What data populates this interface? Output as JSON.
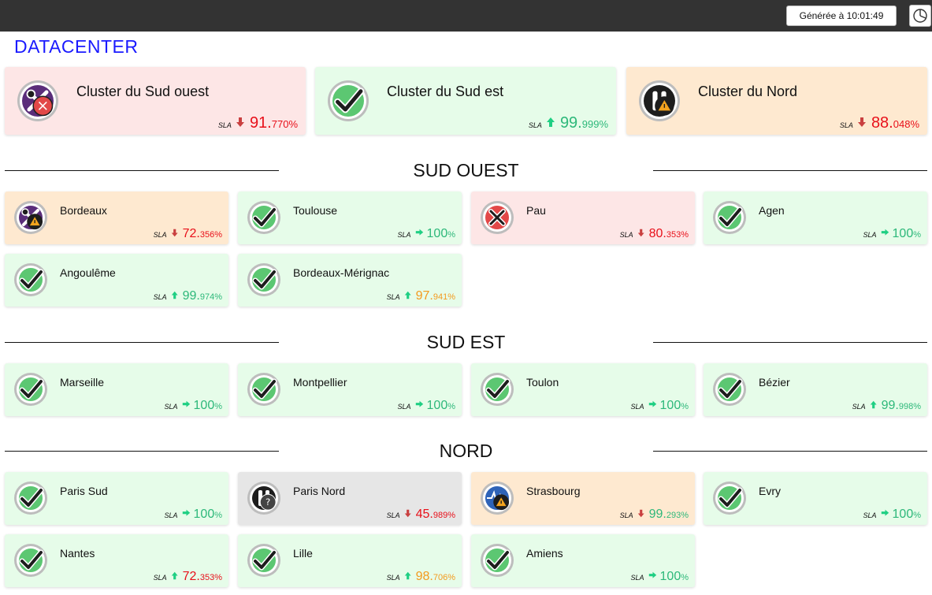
{
  "header": {
    "generated_label": "Générée à 10:01:49",
    "pie_icon": "pie-chart-icon"
  },
  "page_title": "DATACENTER",
  "sla_label": "SLA",
  "colors": {
    "ok": "#e6fce9",
    "critical": "#fde6e6",
    "warning": "#fee9d0",
    "unknown": "#e6e6e6",
    "value_green": "#2db87a",
    "value_red": "#e8101a",
    "value_orange": "#f39a1e",
    "arrow_green": "#1fcf83",
    "arrow_red": "#c94040"
  },
  "clusters": [
    {
      "name": "Cluster du Sud ouest",
      "status": "crit",
      "icon": "maintenance-critical",
      "trend": "down",
      "int": "91.",
      "dec": "770%",
      "color": "red"
    },
    {
      "name": "Cluster du Sud est",
      "status": "ok",
      "icon": "check",
      "trend": "up",
      "int": "99.",
      "dec": "999%",
      "color": "green"
    },
    {
      "name": "Cluster du Nord",
      "status": "warn",
      "icon": "pause-warning",
      "trend": "down",
      "int": "88.",
      "dec": "048%",
      "color": "red"
    }
  ],
  "sections": [
    {
      "title": "SUD OUEST",
      "sites": [
        {
          "name": "Bordeaux",
          "status": "warn",
          "icon": "maintenance-warning",
          "trend": "down",
          "int": "72.",
          "dec": "356%",
          "color": "red"
        },
        {
          "name": "Toulouse",
          "status": "ok",
          "icon": "check",
          "trend": "right",
          "int": "100",
          "dec": "%",
          "color": "green"
        },
        {
          "name": "Pau",
          "status": "crit",
          "icon": "cross",
          "trend": "down",
          "int": "80.",
          "dec": "353%",
          "color": "red"
        },
        {
          "name": "Agen",
          "status": "ok",
          "icon": "check",
          "trend": "right",
          "int": "100",
          "dec": "%",
          "color": "green"
        },
        {
          "name": "Angoulême",
          "status": "ok",
          "icon": "check",
          "trend": "up",
          "int": "99.",
          "dec": "974%",
          "color": "green"
        },
        {
          "name": "Bordeaux-Mérignac",
          "status": "ok",
          "icon": "check",
          "trend": "up",
          "int": "97.",
          "dec": "941%",
          "color": "orange"
        }
      ]
    },
    {
      "title": "SUD EST",
      "sites": [
        {
          "name": "Marseille",
          "status": "ok",
          "icon": "check",
          "trend": "right",
          "int": "100",
          "dec": "%",
          "color": "green"
        },
        {
          "name": "Montpellier",
          "status": "ok",
          "icon": "check",
          "trend": "right",
          "int": "100",
          "dec": "%",
          "color": "green"
        },
        {
          "name": "Toulon",
          "status": "ok",
          "icon": "check",
          "trend": "right",
          "int": "100",
          "dec": "%",
          "color": "green"
        },
        {
          "name": "Bézier",
          "status": "ok",
          "icon": "check",
          "trend": "up",
          "int": "99.",
          "dec": "998%",
          "color": "green"
        }
      ]
    },
    {
      "title": "NORD",
      "sites": [
        {
          "name": "Paris Sud",
          "status": "ok",
          "icon": "check",
          "trend": "right",
          "int": "100",
          "dec": "%",
          "color": "green"
        },
        {
          "name": "Paris Nord",
          "status": "unk",
          "icon": "pause-unknown",
          "trend": "down",
          "int": "45.",
          "dec": "989%",
          "color": "red"
        },
        {
          "name": "Strasbourg",
          "status": "warn",
          "icon": "pulse-warning",
          "trend": "down",
          "int": "99.",
          "dec": "293%",
          "color": "green"
        },
        {
          "name": "Evry",
          "status": "ok",
          "icon": "check",
          "trend": "right",
          "int": "100",
          "dec": "%",
          "color": "green"
        },
        {
          "name": "Nantes",
          "status": "ok",
          "icon": "check",
          "trend": "up",
          "int": "72.",
          "dec": "353%",
          "color": "red"
        },
        {
          "name": "Lille",
          "status": "ok",
          "icon": "check",
          "trend": "up",
          "int": "98.",
          "dec": "706%",
          "color": "orange"
        },
        {
          "name": "Amiens",
          "status": "ok",
          "icon": "check",
          "trend": "right",
          "int": "100",
          "dec": "%",
          "color": "green"
        }
      ]
    }
  ]
}
